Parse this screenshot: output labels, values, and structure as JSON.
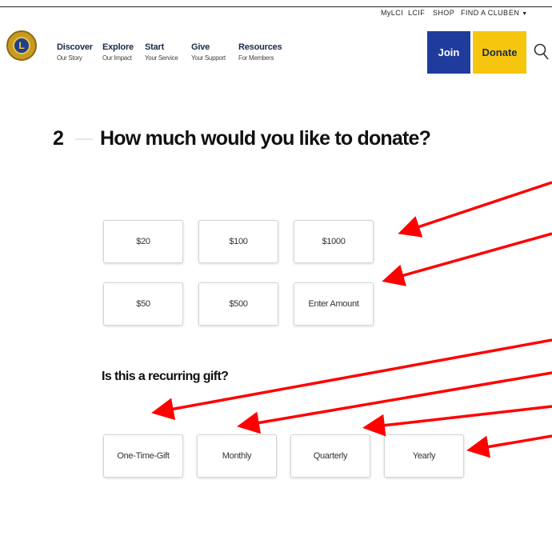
{
  "utility_nav": {
    "mylci": "MyLCI",
    "lcif": "LCIF",
    "shop": "SHOP",
    "find_club": "FIND A CLUB",
    "language": "EN"
  },
  "logo": {
    "letter": "L"
  },
  "main_nav": [
    {
      "label": "Discover",
      "sub": "Our Story"
    },
    {
      "label": "Explore",
      "sub": "Our Impact"
    },
    {
      "label": "Start",
      "sub": "Your Service"
    },
    {
      "label": "Give",
      "sub": "Your Support"
    },
    {
      "label": "Resources",
      "sub": "For Members"
    }
  ],
  "actions": {
    "join": "Join",
    "donate": "Donate"
  },
  "step": {
    "number": "2",
    "question": "How much would you like to donate?"
  },
  "amounts": [
    "$20",
    "$100",
    "$1000",
    "$50",
    "$500",
    "Enter Amount"
  ],
  "recurring": {
    "question": "Is this a recurring gift?",
    "options": [
      "One-Time-Gift",
      "Monthly",
      "Quarterly",
      "Yearly"
    ]
  },
  "colors": {
    "join_bg": "#1f3c9c",
    "donate_bg": "#f6c60f",
    "annotation_arrow": "#ff0000"
  },
  "icons": {
    "search": "search-icon",
    "language_caret": "caret-down-icon"
  }
}
